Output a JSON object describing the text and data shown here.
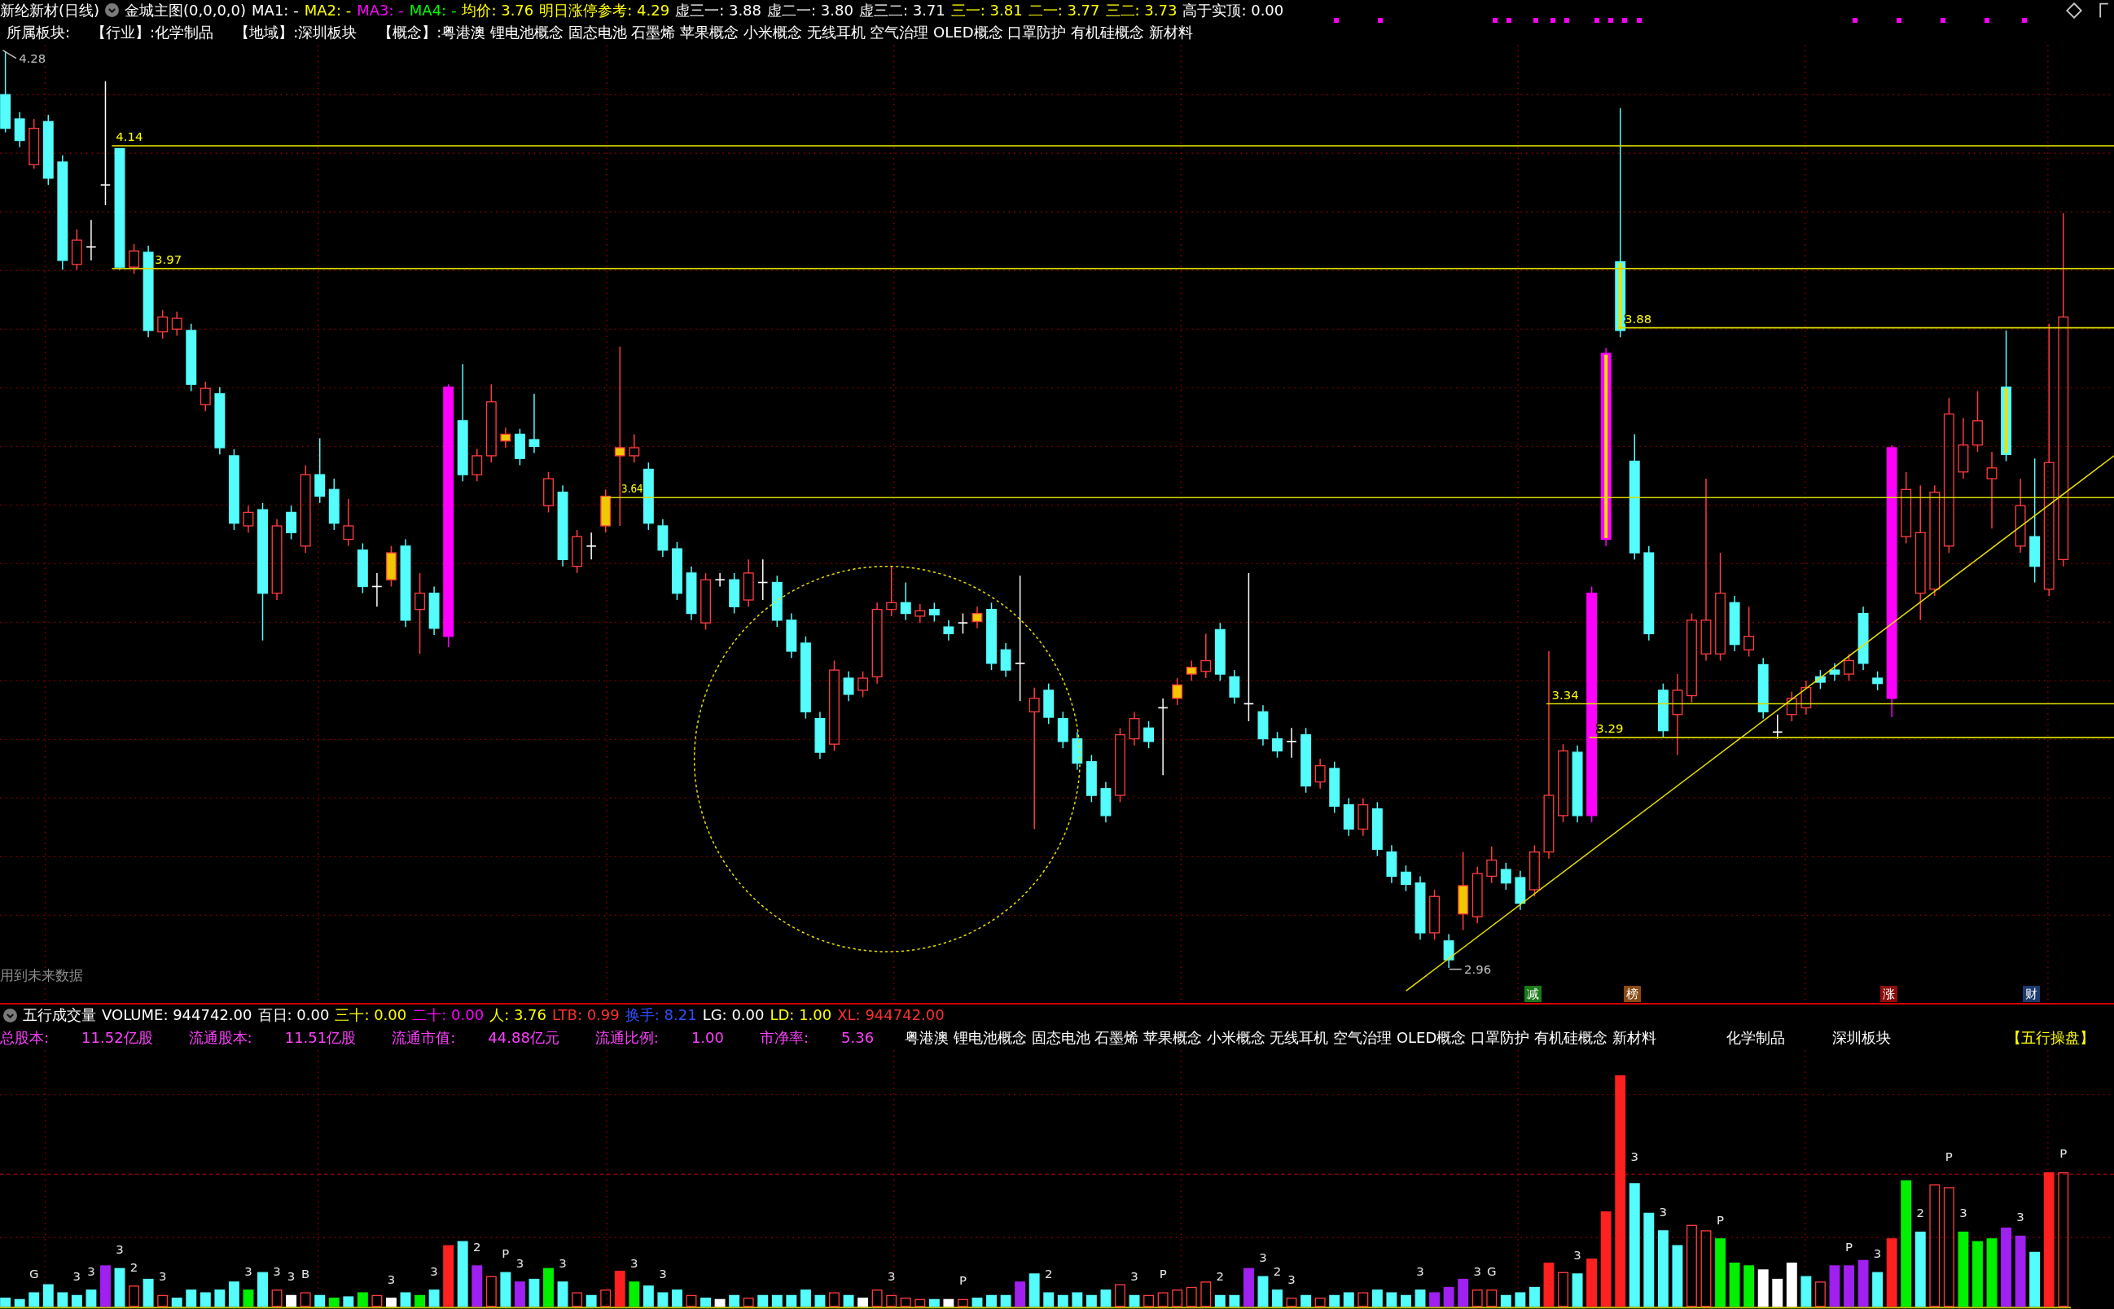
{
  "header": {
    "title": "新纶新材(日线)",
    "indicator": "金城主图(0,0,0,0)",
    "readouts": [
      {
        "text": "MA1: -",
        "color": "#ffffff"
      },
      {
        "text": "MA2: -",
        "color": "#ffff00"
      },
      {
        "text": "MA3: -",
        "color": "#ff00ff"
      },
      {
        "text": "MA4: -",
        "color": "#00ff00"
      },
      {
        "text": "均价: 3.76",
        "color": "#ffff00"
      },
      {
        "text": "明日涨停参考: 4.29",
        "color": "#ffff00"
      },
      {
        "text": "虚三一: 3.88",
        "color": "#ffffff"
      },
      {
        "text": "虚二一: 3.80",
        "color": "#ffffff"
      },
      {
        "text": "虚三二: 3.71",
        "color": "#ffffff"
      },
      {
        "text": "三一: 3.81",
        "color": "#ffff00"
      },
      {
        "text": "二一: 3.77",
        "color": "#ffff00"
      },
      {
        "text": "三二: 3.73",
        "color": "#ffff00"
      },
      {
        "text": "高于实顶: 0.00",
        "color": "#ffffff"
      }
    ]
  },
  "sector_row": {
    "title": "所属板块:",
    "groups": [
      {
        "label": "【行业】:",
        "value": "化学制品"
      },
      {
        "label": "【地域】:",
        "value": "深圳板块"
      },
      {
        "label": "【概念】:",
        "value": "粤港澳 锂电池概念 固态电池 石墨烯 苹果概念 小米概念 无线耳机 空气治理 OLED概念 口罩防护 有机硅概念 新材料"
      }
    ]
  },
  "main_chart": {
    "high_label": "4.28",
    "price_lines": [
      {
        "label": "4.14"
      },
      {
        "label": "3.97"
      },
      {
        "label": "3.88"
      },
      {
        "label": "3.64"
      },
      {
        "label": "3.34"
      },
      {
        "label": "3.29"
      }
    ],
    "low_label": "2.96",
    "note": "用到未来数据",
    "signals": [
      {
        "text": "减",
        "color": "#1a7a1a"
      },
      {
        "text": "榜",
        "color": "#8a4a14"
      },
      {
        "text": "涨",
        "color": "#8c0c0c"
      },
      {
        "text": "财",
        "color": "#1c3a6c"
      }
    ]
  },
  "volume_panel": {
    "title": "五行成交量",
    "readouts": [
      {
        "text": "VOLUME: 944742.00",
        "color": "#ffffff"
      },
      {
        "text": "百日: 0.00",
        "color": "#ffffff"
      },
      {
        "text": "三十: 0.00",
        "color": "#ffff00"
      },
      {
        "text": "二十: 0.00",
        "color": "#ff00ff"
      },
      {
        "text": "人: 3.76",
        "color": "#ffff00"
      },
      {
        "text": "LTB: 0.99",
        "color": "#ff3030"
      },
      {
        "text": "换手: 8.21",
        "color": "#3050ff"
      },
      {
        "text": "LG: 0.00",
        "color": "#ffffff"
      },
      {
        "text": "LD: 1.00",
        "color": "#ffff00"
      },
      {
        "text": "XL: 944742.00",
        "color": "#ff3030"
      }
    ],
    "stats": [
      {
        "label": "总股本:",
        "value": "11.52亿股"
      },
      {
        "label": "流通股本:",
        "value": "11.51亿股"
      },
      {
        "label": "流通市值:",
        "value": "44.88亿元"
      },
      {
        "label": "流通比例:",
        "value": "1.00"
      },
      {
        "label": "市净率:",
        "value": "5.36"
      }
    ],
    "concepts": "粤港澳 锂电池概念 固态电池 石墨烯 苹果概念 小米概念 无线耳机 空气治理 OLED概念 口罩防护 有机硅概念 新材料",
    "industry": "化学制品",
    "region": "深圳板块",
    "brand": "【五行操盘】",
    "bar_marks": [
      "G",
      "3",
      "3",
      "3",
      "2",
      "3",
      "3",
      "3",
      "3",
      "B",
      "3",
      "3",
      "2",
      "P",
      "3",
      "3",
      "3",
      "3",
      "3",
      "P",
      "2",
      "3",
      "P",
      "2",
      "3",
      "2",
      "3",
      "3",
      "3",
      "G",
      "3",
      "3",
      "3",
      "P",
      "P",
      "3",
      "2",
      "P",
      "3",
      "3",
      "P"
    ]
  }
}
